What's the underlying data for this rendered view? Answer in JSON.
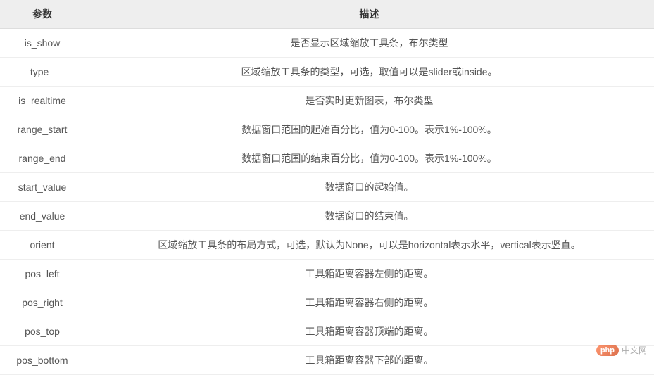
{
  "table": {
    "headers": {
      "param": "参数",
      "description": "描述"
    },
    "rows": [
      {
        "param": "is_show",
        "description": "是否显示区域缩放工具条，布尔类型"
      },
      {
        "param": "type_",
        "description": "区域缩放工具条的类型，可选，取值可以是slider或inside。"
      },
      {
        "param": "is_realtime",
        "description": "是否实时更新图表，布尔类型"
      },
      {
        "param": "range_start",
        "description": "数据窗口范围的起始百分比，值为0-100。表示1%-100%。"
      },
      {
        "param": "range_end",
        "description": "数据窗口范围的结束百分比，值为0-100。表示1%-100%。"
      },
      {
        "param": "start_value",
        "description": "数据窗口的起始值。"
      },
      {
        "param": "end_value",
        "description": "数据窗口的结束值。"
      },
      {
        "param": "orient",
        "description": "区域缩放工具条的布局方式，可选，默认为None，可以是horizontal表示水平，vertical表示竖直。"
      },
      {
        "param": "pos_left",
        "description": "工具箱距离容器左侧的距离。"
      },
      {
        "param": "pos_right",
        "description": "工具箱距离容器右侧的距离。"
      },
      {
        "param": "pos_top",
        "description": "工具箱距离容器顶端的距离。"
      },
      {
        "param": "pos_bottom",
        "description": "工具箱距离容器下部的距离。"
      }
    ]
  },
  "watermark": {
    "logo": "php",
    "text": "中文网"
  }
}
